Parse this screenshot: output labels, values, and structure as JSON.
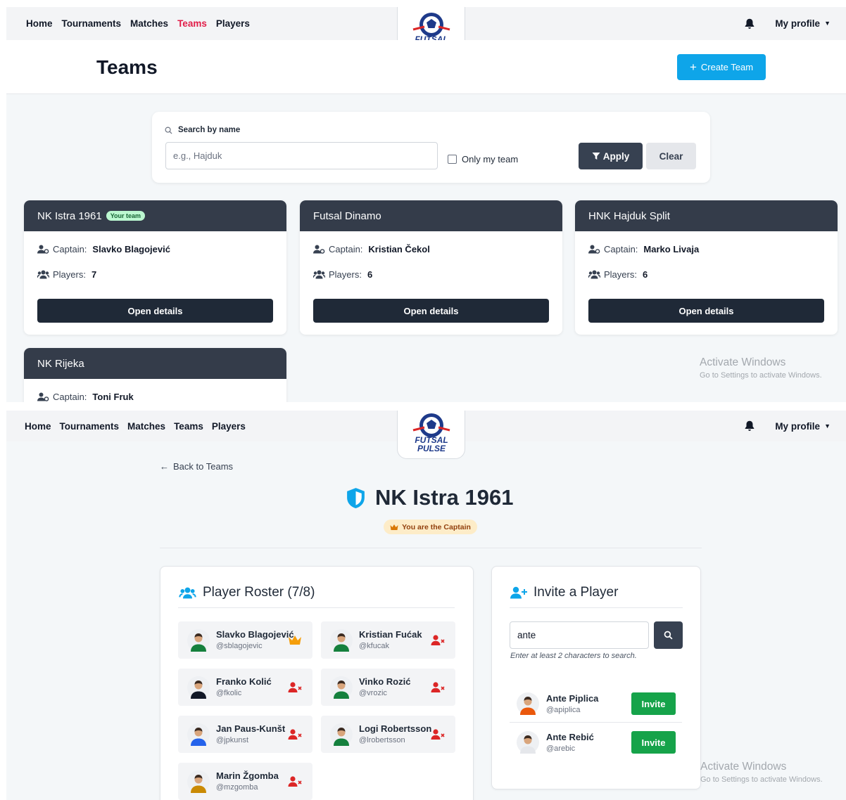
{
  "nav": {
    "links": [
      "Home",
      "Tournaments",
      "Matches",
      "Teams",
      "Players"
    ],
    "profile_label": "My profile",
    "brand_line1": "FUTSAL",
    "brand_line2": "PULSE"
  },
  "teams_page": {
    "title": "Teams",
    "create_button": "Create Team",
    "filter": {
      "search_label": "Search by name",
      "search_placeholder": "e.g., Hajduk",
      "only_my_team_label": "Only my team",
      "apply_label": "Apply",
      "clear_label": "Clear"
    },
    "captain_label": "Captain:",
    "players_label": "Players:",
    "open_details_label": "Open details",
    "teams": [
      {
        "name": "NK Istra 1961",
        "badge": "Your team",
        "captain": "Slavko Blagojević",
        "players": "7"
      },
      {
        "name": "Futsal Dinamo",
        "badge": "",
        "captain": "Kristian Čekol",
        "players": "6"
      },
      {
        "name": "HNK Hajduk Split",
        "badge": "",
        "captain": "Marko Livaja",
        "players": "6"
      },
      {
        "name": "NK Rijeka",
        "badge": "",
        "captain": "Toni Fruk",
        "players": ""
      }
    ]
  },
  "watermark": {
    "title": "Activate Windows",
    "subtitle": "Go to Settings to activate Windows."
  },
  "team_detail": {
    "back_label": "Back to Teams",
    "team_name": "NK Istra 1961",
    "captain_badge": "You are the Captain",
    "roster_title": "Player Roster (7/8)",
    "roster": [
      {
        "name": "Slavko Blagojević",
        "username": "@sblagojevic",
        "role": "captain",
        "kit": "#15803d"
      },
      {
        "name": "Kristian Fućak",
        "username": "@kfucak",
        "role": "remove",
        "kit": "#15803d"
      },
      {
        "name": "Franko Kolić",
        "username": "@fkolic",
        "role": "remove",
        "kit": "#111827"
      },
      {
        "name": "Vinko Rozić",
        "username": "@vrozic",
        "role": "remove",
        "kit": "#15803d"
      },
      {
        "name": "Jan Paus-Kunšt",
        "username": "@jpkunst",
        "role": "remove",
        "kit": "#2563eb"
      },
      {
        "name": "Logi Robertsson",
        "username": "@lrobertsson",
        "role": "remove",
        "kit": "#15803d"
      },
      {
        "name": "Marin Žgomba",
        "username": "@mzgomba",
        "role": "remove",
        "kit": "#ca8a04"
      }
    ],
    "invite": {
      "title": "Invite a Player",
      "search_value": "ante",
      "hint": "Enter at least 2 characters to search.",
      "button_label": "Invite",
      "candidates": [
        {
          "name": "Ante Piplica",
          "username": "@apiplica",
          "kit": "#ea580c"
        },
        {
          "name": "Ante Rebić",
          "username": "@arebic",
          "kit": "#e5e7eb"
        }
      ]
    }
  },
  "colors": {
    "accent": "#0ea5e9",
    "active_nav": "#e11d48",
    "card_header": "#343c4a",
    "dark_button": "#1f2937",
    "invite_green": "#16a34a",
    "remove_red": "#dc2626",
    "crown_gold": "#f59e0b"
  },
  "icons": [
    "bell-icon",
    "caret-down-icon",
    "plus-icon",
    "search-icon",
    "filter-icon",
    "user-tie-icon",
    "users-icon",
    "arrow-left-icon",
    "shield-icon",
    "crown-icon",
    "user-remove-icon",
    "user-plus-icon"
  ]
}
